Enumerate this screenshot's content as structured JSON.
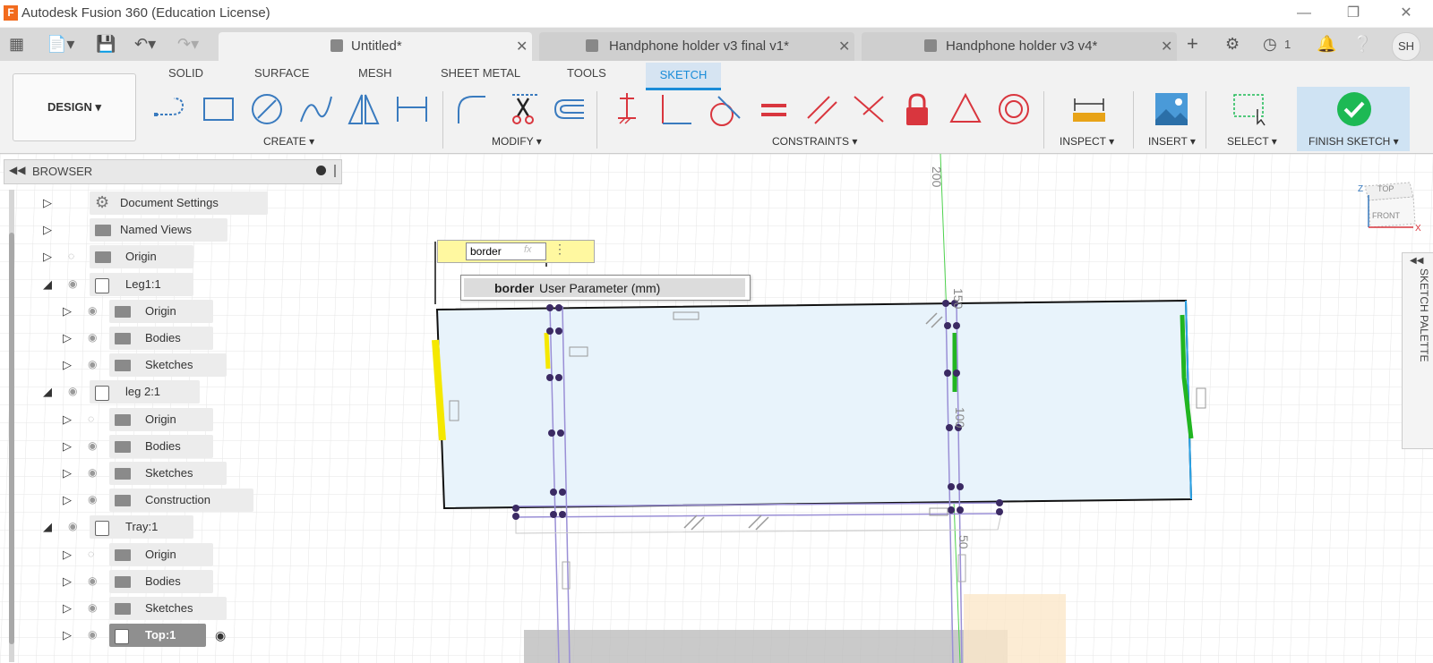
{
  "window": {
    "title": "Autodesk Fusion 360 (Education License)",
    "logo": "F",
    "controls": [
      "minimize-icon",
      "restore-icon",
      "close-icon"
    ]
  },
  "tabs": [
    {
      "label": "Untitled*",
      "active": true
    },
    {
      "label": "Handphone holder v3 final v1*",
      "active": false
    },
    {
      "label": "Handphone holder v3 v4*",
      "active": false
    }
  ],
  "quick_toolbar": {
    "job_count": "1",
    "user_initials": "SH"
  },
  "workspace_tabs": [
    "SOLID",
    "SURFACE",
    "MESH",
    "SHEET METAL",
    "TOOLS",
    "SKETCH"
  ],
  "design_button": "DESIGN ▾",
  "groups": {
    "create": "CREATE ▾",
    "modify": "MODIFY ▾",
    "constraints": "CONSTRAINTS ▾",
    "inspect": "INSPECT ▾",
    "insert": "INSERT ▾",
    "select": "SELECT ▾",
    "finish": "FINISH SKETCH ▾"
  },
  "browser": {
    "title": "BROWSER",
    "nodes": [
      {
        "label": "Document Settings",
        "depth": 0,
        "icon": "gear-icon",
        "eye": "none",
        "expanded": false
      },
      {
        "label": "Named Views",
        "depth": 0,
        "icon": "folder-icon",
        "eye": "none",
        "expanded": false
      },
      {
        "label": "Origin",
        "depth": 0,
        "icon": "folder-icon",
        "eye": "hidden",
        "expanded": false
      },
      {
        "label": "Leg1:1",
        "depth": 0,
        "icon": "component-icon",
        "eye": "visible",
        "expanded": true
      },
      {
        "label": "Origin",
        "depth": 1,
        "icon": "folder-icon",
        "eye": "visible",
        "expanded": false
      },
      {
        "label": "Bodies",
        "depth": 1,
        "icon": "folder-icon",
        "eye": "visible",
        "expanded": false
      },
      {
        "label": "Sketches",
        "depth": 1,
        "icon": "folder-icon",
        "eye": "visible",
        "expanded": false
      },
      {
        "label": "leg 2:1",
        "depth": 0,
        "icon": "component-icon",
        "eye": "visible",
        "expanded": true
      },
      {
        "label": "Origin",
        "depth": 1,
        "icon": "folder-icon",
        "eye": "hidden",
        "expanded": false
      },
      {
        "label": "Bodies",
        "depth": 1,
        "icon": "folder-icon",
        "eye": "visible",
        "expanded": false
      },
      {
        "label": "Sketches",
        "depth": 1,
        "icon": "folder-icon",
        "eye": "visible",
        "expanded": false
      },
      {
        "label": "Construction",
        "depth": 1,
        "icon": "folder-icon",
        "eye": "visible",
        "expanded": false
      },
      {
        "label": "Tray:1",
        "depth": 0,
        "icon": "component-icon",
        "eye": "visible",
        "expanded": true
      },
      {
        "label": "Origin",
        "depth": 1,
        "icon": "folder-icon",
        "eye": "hidden",
        "expanded": false
      },
      {
        "label": "Bodies",
        "depth": 1,
        "icon": "folder-icon",
        "eye": "visible",
        "expanded": false
      },
      {
        "label": "Sketches",
        "depth": 1,
        "icon": "folder-icon",
        "eye": "visible",
        "expanded": false
      },
      {
        "label": "Top:1",
        "depth": 1,
        "icon": "component-icon",
        "eye": "visible",
        "expanded": false,
        "selected": true
      }
    ]
  },
  "parameter_input": {
    "value": "border",
    "fx": "fx"
  },
  "autocomplete": {
    "name": "border",
    "description": "User Parameter (mm)"
  },
  "view_cube": {
    "top": "TOP",
    "front": "FRONT",
    "axis_x": "X",
    "axis_z": "Z"
  },
  "grid_labels": {
    "label_200": "200",
    "label_150": "150",
    "label_100": "100",
    "label_50": "50"
  },
  "sketch_palette": "SKETCH PALETTE",
  "colors": {
    "accent": "#1a8cd8",
    "finish_check": "#1db954",
    "sketch_fill": "#e8f3fb",
    "highlight": "#f5e800",
    "constraint_red": "#d9363e"
  }
}
